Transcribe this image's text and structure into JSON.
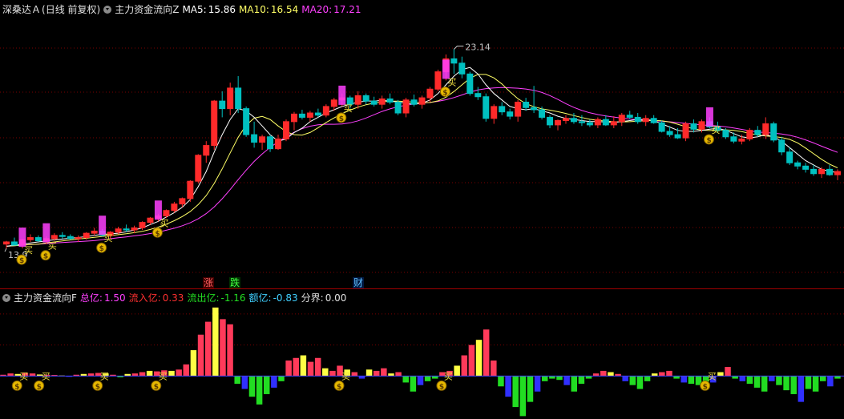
{
  "header_main": {
    "stock_name": "深桑达Ａ",
    "period": "(日线 前复权)",
    "indicator": "主力资金流向Z",
    "ma5_label": "MA5:",
    "ma5_value": "15.86",
    "ma10_label": "MA10:",
    "ma10_value": "16.54",
    "ma20_label": "MA20:",
    "ma20_value": "17.21"
  },
  "header_sub": {
    "indicator": "主力资金流向F",
    "total_label": "总亿:",
    "total_value": "1.50",
    "inflow_label": "流入亿:",
    "inflow_value": "0.33",
    "outflow_label": "流出亿:",
    "outflow_value": "-1.16",
    "net_label": "额亿:",
    "net_value": "-0.83",
    "boundary_label": "分界:",
    "boundary_value": "0.00"
  },
  "annotations": {
    "high": "23.14",
    "low": "13.9",
    "buy_label": "买",
    "event_rise": "涨",
    "event_fall": "跌",
    "event_finance": "财"
  },
  "colors": {
    "up": "#ff2a2a",
    "down": "#00c0c0",
    "ma5": "#ffffff",
    "ma10": "#ffff66",
    "ma20": "#ff40ff",
    "flow_in": "#ff3a5a",
    "flow_in2": "#ffff44",
    "flow_out": "#22dd22",
    "flow_out2": "#3030ff",
    "buy_icon": "#e6b800",
    "grid": "#7a0000"
  },
  "chart_data": {
    "type": "candlestick",
    "price_range": [
      12.4,
      24.6
    ],
    "candles": [
      [
        14.15,
        14.3,
        13.95,
        14.25
      ],
      [
        14.25,
        14.45,
        14.1,
        14.1
      ],
      [
        14.1,
        14.4,
        13.95,
        14.35
      ],
      [
        14.35,
        14.6,
        14.25,
        14.45
      ],
      [
        14.45,
        14.55,
        14.25,
        14.3
      ],
      [
        14.3,
        14.5,
        14.15,
        14.4
      ],
      [
        14.4,
        14.65,
        14.3,
        14.55
      ],
      [
        14.55,
        14.7,
        14.4,
        14.5
      ],
      [
        14.5,
        14.6,
        14.35,
        14.4
      ],
      [
        14.4,
        14.55,
        14.25,
        14.45
      ],
      [
        14.45,
        14.7,
        14.35,
        14.65
      ],
      [
        14.65,
        14.9,
        14.55,
        14.75
      ],
      [
        14.75,
        14.85,
        14.5,
        14.55
      ],
      [
        14.55,
        14.75,
        14.4,
        14.7
      ],
      [
        14.7,
        14.95,
        14.6,
        14.85
      ],
      [
        14.85,
        15.05,
        14.7,
        14.8
      ],
      [
        14.8,
        15.0,
        14.65,
        14.9
      ],
      [
        14.9,
        15.2,
        14.8,
        15.15
      ],
      [
        15.15,
        15.4,
        15.05,
        15.35
      ],
      [
        15.35,
        15.55,
        15.2,
        15.45
      ],
      [
        15.45,
        15.75,
        15.35,
        15.7
      ],
      [
        15.7,
        16.1,
        15.6,
        16.0
      ],
      [
        16.0,
        16.3,
        15.85,
        16.25
      ],
      [
        16.25,
        17.1,
        16.1,
        17.05
      ],
      [
        17.05,
        18.3,
        16.95,
        18.25
      ],
      [
        18.25,
        18.9,
        17.9,
        18.7
      ],
      [
        18.7,
        20.8,
        18.5,
        20.75
      ],
      [
        20.75,
        21.2,
        20.0,
        20.4
      ],
      [
        20.4,
        21.6,
        20.1,
        21.35
      ],
      [
        21.35,
        21.9,
        20.2,
        20.4
      ],
      [
        20.4,
        20.5,
        19.1,
        19.2
      ],
      [
        19.2,
        19.8,
        18.6,
        18.85
      ],
      [
        18.85,
        19.2,
        18.5,
        19.1
      ],
      [
        19.1,
        19.2,
        18.4,
        18.55
      ],
      [
        18.55,
        19.2,
        18.5,
        19.0
      ],
      [
        19.0,
        19.9,
        18.9,
        19.8
      ],
      [
        19.8,
        20.25,
        19.4,
        20.15
      ],
      [
        20.15,
        20.35,
        19.9,
        20.0
      ],
      [
        20.0,
        20.3,
        19.8,
        20.2
      ],
      [
        20.2,
        20.4,
        20.0,
        20.1
      ],
      [
        20.1,
        20.6,
        20.0,
        20.5
      ],
      [
        20.5,
        20.9,
        20.3,
        20.8
      ],
      [
        20.8,
        21.1,
        20.5,
        20.9
      ],
      [
        20.9,
        21.0,
        20.4,
        20.6
      ],
      [
        20.6,
        21.2,
        20.4,
        21.0
      ],
      [
        21.0,
        21.1,
        20.6,
        20.75
      ],
      [
        20.75,
        20.95,
        20.5,
        20.6
      ],
      [
        20.6,
        21.0,
        20.4,
        20.85
      ],
      [
        20.85,
        21.1,
        20.6,
        20.7
      ],
      [
        20.7,
        20.8,
        20.1,
        20.2
      ],
      [
        20.2,
        20.9,
        20.0,
        20.8
      ],
      [
        20.8,
        21.05,
        20.5,
        20.6
      ],
      [
        20.6,
        21.0,
        20.4,
        20.9
      ],
      [
        20.9,
        21.4,
        20.7,
        21.3
      ],
      [
        21.3,
        22.2,
        21.2,
        22.1
      ],
      [
        22.1,
        22.9,
        21.7,
        22.7
      ],
      [
        22.7,
        23.14,
        22.0,
        22.5
      ],
      [
        22.5,
        22.8,
        21.8,
        22.0
      ],
      [
        22.0,
        22.1,
        21.0,
        21.1
      ],
      [
        21.1,
        21.4,
        20.8,
        20.95
      ],
      [
        20.95,
        21.1,
        19.8,
        19.95
      ],
      [
        19.95,
        20.6,
        19.7,
        20.5
      ],
      [
        20.5,
        20.7,
        20.1,
        20.25
      ],
      [
        20.25,
        20.4,
        19.9,
        20.05
      ],
      [
        20.05,
        20.8,
        19.8,
        20.7
      ],
      [
        20.7,
        20.9,
        20.3,
        20.45
      ],
      [
        20.45,
        21.45,
        20.2,
        20.35
      ],
      [
        20.35,
        20.5,
        19.9,
        20.0
      ],
      [
        20.0,
        20.1,
        19.5,
        19.65
      ],
      [
        19.65,
        19.9,
        19.4,
        19.85
      ],
      [
        19.85,
        20.1,
        19.7,
        19.95
      ],
      [
        19.95,
        20.2,
        19.7,
        19.8
      ],
      [
        19.8,
        20.1,
        19.6,
        19.75
      ],
      [
        19.75,
        19.9,
        19.55,
        19.65
      ],
      [
        19.65,
        20.0,
        19.5,
        19.9
      ],
      [
        19.9,
        20.1,
        19.6,
        19.65
      ],
      [
        19.65,
        20.05,
        19.5,
        19.8
      ],
      [
        19.8,
        20.2,
        19.6,
        20.1
      ],
      [
        20.1,
        20.3,
        19.9,
        20.0
      ],
      [
        20.0,
        20.2,
        19.7,
        19.8
      ],
      [
        19.8,
        20.1,
        19.6,
        19.95
      ],
      [
        19.95,
        20.1,
        19.7,
        19.75
      ],
      [
        19.75,
        19.85,
        19.3,
        19.35
      ],
      [
        19.35,
        19.6,
        19.1,
        19.2
      ],
      [
        19.2,
        19.5,
        19.0,
        19.05
      ],
      [
        19.05,
        19.8,
        18.9,
        19.7
      ],
      [
        19.7,
        19.9,
        19.3,
        19.45
      ],
      [
        19.45,
        19.9,
        19.3,
        19.8
      ],
      [
        19.8,
        20.0,
        19.5,
        19.55
      ],
      [
        19.55,
        19.8,
        19.3,
        19.4
      ],
      [
        19.4,
        19.5,
        19.0,
        19.1
      ],
      [
        19.1,
        19.3,
        18.8,
        18.9
      ],
      [
        18.9,
        19.2,
        18.75,
        19.0
      ],
      [
        19.0,
        19.5,
        18.9,
        19.4
      ],
      [
        19.4,
        19.6,
        19.1,
        19.2
      ],
      [
        19.2,
        20.0,
        19.0,
        19.7
      ],
      [
        19.7,
        19.8,
        18.85,
        18.95
      ],
      [
        18.95,
        19.1,
        18.25,
        18.4
      ],
      [
        18.4,
        18.6,
        17.8,
        17.9
      ],
      [
        17.9,
        18.0,
        17.6,
        17.75
      ],
      [
        17.75,
        17.9,
        17.45,
        17.6
      ],
      [
        17.6,
        17.8,
        17.3,
        17.4
      ],
      [
        17.4,
        17.7,
        17.2,
        17.6
      ],
      [
        17.6,
        17.8,
        17.3,
        17.35
      ],
      [
        17.35,
        17.6,
        17.1,
        17.5
      ]
    ],
    "ma5": [
      14.05,
      14.1,
      14.15,
      14.2,
      14.25,
      14.3,
      14.35,
      14.38,
      14.42,
      14.45,
      14.5,
      14.55,
      14.6,
      14.62,
      14.65,
      14.72,
      14.8,
      14.9,
      15.05,
      15.2,
      15.4,
      15.6,
      15.85,
      16.2,
      16.8,
      17.5,
      18.4,
      19.2,
      19.9,
      20.4,
      20.3,
      20.0,
      19.6,
      19.2,
      18.9,
      19.0,
      19.3,
      19.5,
      19.8,
      20.0,
      20.2,
      20.35,
      20.5,
      20.6,
      20.7,
      20.75,
      20.75,
      20.78,
      20.75,
      20.7,
      20.65,
      20.6,
      20.65,
      20.8,
      21.1,
      21.5,
      21.9,
      22.2,
      22.3,
      22.0,
      21.5,
      21.1,
      20.8,
      20.5,
      20.4,
      20.35,
      20.4,
      20.3,
      20.2,
      20.05,
      19.95,
      19.9,
      19.85,
      19.8,
      19.8,
      19.78,
      19.76,
      19.8,
      19.85,
      19.9,
      19.9,
      19.85,
      19.7,
      19.55,
      19.4,
      19.35,
      19.35,
      19.4,
      19.45,
      19.5,
      19.4,
      19.25,
      19.1,
      19.05,
      19.1,
      19.2,
      19.1,
      18.9,
      18.6,
      18.3,
      18.0,
      17.8,
      17.6,
      17.5,
      17.45
    ]
  },
  "flow_data": {
    "type": "bar",
    "range": [
      -1.6,
      2.8
    ],
    "values": [
      0.05,
      0.1,
      0.08,
      0.12,
      0.1,
      0.06,
      0.05,
      0.04,
      0.02,
      -0.03,
      0.05,
      0.08,
      0.1,
      0.12,
      0.1,
      0.05,
      -0.05,
      0.08,
      0.1,
      0.15,
      0.2,
      0.18,
      0.22,
      0.2,
      0.25,
      0.45,
      1.0,
      1.6,
      2.1,
      2.65,
      2.2,
      2.0,
      -0.3,
      -0.5,
      -0.8,
      -1.1,
      -0.7,
      -0.45,
      -0.2,
      0.6,
      0.7,
      0.8,
      0.55,
      0.7,
      0.3,
      0.2,
      0.4,
      0.25,
      0.15,
      -0.1,
      0.25,
      0.2,
      0.3,
      0.1,
      0.15,
      -0.25,
      -0.6,
      -0.35,
      -0.2,
      -0.1,
      0.15,
      0.2,
      0.4,
      0.8,
      1.2,
      1.4,
      1.8,
      0.6,
      -0.4,
      -0.8,
      -1.2,
      -1.55,
      -1.0,
      -0.6,
      -0.2,
      -0.1,
      -0.15,
      -0.35,
      -0.6,
      -0.3,
      -0.1,
      0.1,
      0.2,
      0.15,
      0.08,
      -0.2,
      -0.35,
      -0.5,
      -0.2,
      0.1,
      0.15,
      0.2,
      -0.1,
      -0.25,
      -0.3,
      -0.35,
      -0.5,
      -0.25,
      0.15,
      0.35,
      -0.1,
      -0.2,
      -0.3,
      -0.45,
      -0.6,
      -0.2,
      -0.35,
      -0.55,
      -0.7,
      -1.0,
      -0.5,
      -0.6,
      -0.2,
      -0.4,
      -0.1
    ]
  }
}
